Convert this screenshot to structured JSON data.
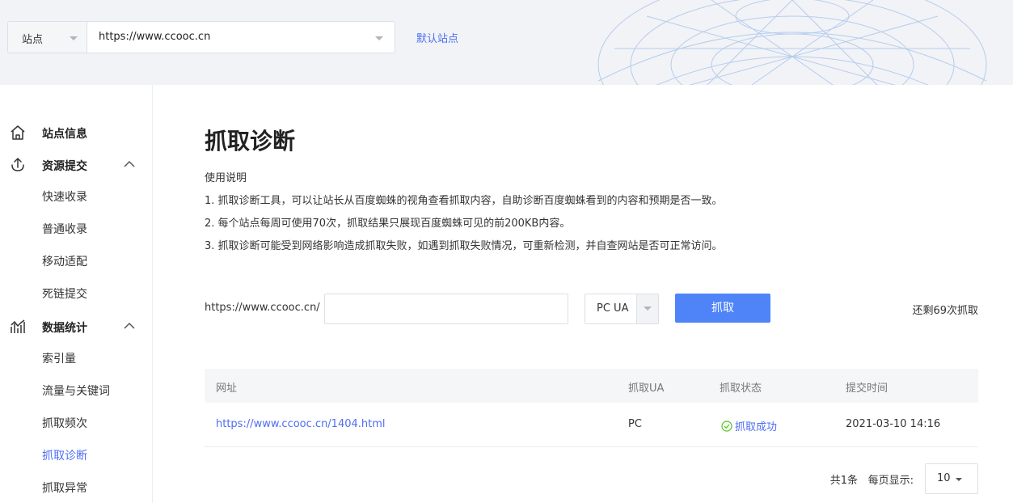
{
  "topbar": {
    "site_label": "站点",
    "site_url": "https://www.ccooc.cn",
    "default_site": "默认站点"
  },
  "sidebar": {
    "groups": [
      {
        "label": "站点信息",
        "icon": "home-icon"
      },
      {
        "label": "资源提交",
        "icon": "submit-icon",
        "items": [
          "快速收录",
          "普通收录",
          "移动适配",
          "死链提交"
        ]
      },
      {
        "label": "数据统计",
        "icon": "stats-icon",
        "items": [
          "索引量",
          "流量与关键词",
          "抓取频次",
          "抓取诊断",
          "抓取异常"
        ]
      }
    ],
    "active_item": "抓取诊断"
  },
  "main": {
    "title": "抓取诊断",
    "guide": [
      "使用说明",
      "1. 抓取诊断工具，可以让站长从百度蜘蛛的视角查看抓取内容，自助诊断百度蜘蛛看到的内容和预期是否一致。",
      "2. 每个站点每周可使用70次，抓取结果只展现百度蜘蛛可见的前200KB内容。",
      "3. 抓取诊断可能受到网络影响造成抓取失败，如遇到抓取失败情况，可重新检测，并自查网站是否可正常访问。"
    ],
    "fetch": {
      "prefix": "https://www.ccooc.cn/",
      "path_value": "",
      "ua": "PC UA",
      "button": "抓取",
      "remaining": "还剩69次抓取"
    },
    "table": {
      "headers": [
        "网址",
        "抓取UA",
        "抓取状态",
        "提交时间"
      ],
      "rows": [
        {
          "url": "https://www.ccooc.cn/1404.html",
          "ua": "PC",
          "status": "抓取成功",
          "time": "2021-03-10 14:16"
        }
      ]
    },
    "pager": {
      "total": "共1条",
      "per_page_label": "每页显示:",
      "page_size": "10"
    }
  },
  "colors": {
    "accent": "#4e6ef2",
    "button": "#4e84f8",
    "success": "#52c41a"
  }
}
